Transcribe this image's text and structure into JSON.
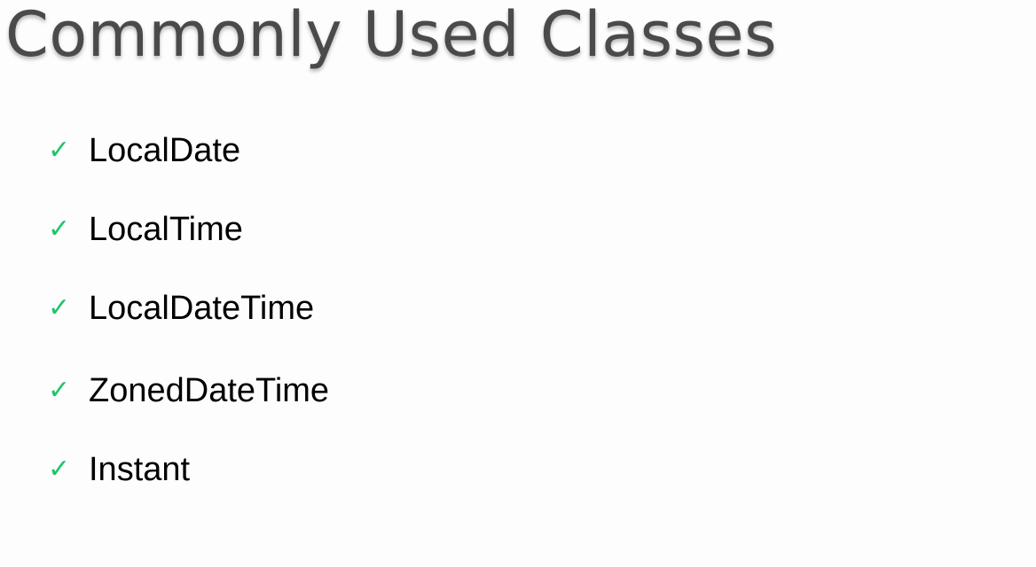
{
  "slide": {
    "title": "Commonly Used Classes",
    "items": [
      {
        "label": "LocalDate",
        "icon": "check-icon"
      },
      {
        "label": "LocalTime",
        "icon": "check-icon"
      },
      {
        "label": "LocalDateTime",
        "icon": "check-icon"
      },
      {
        "label": "ZonedDateTime",
        "icon": "check-icon"
      },
      {
        "label": "Instant",
        "icon": "check-icon"
      }
    ],
    "colors": {
      "background": "#fdfdfd",
      "title": "#4a4a4a",
      "check": "#1fc46a",
      "text": "#000000"
    }
  }
}
